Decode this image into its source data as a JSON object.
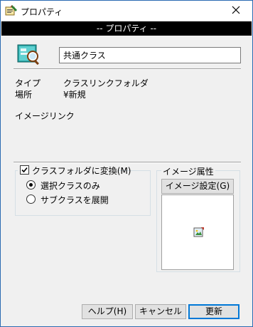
{
  "window": {
    "title": "プロパティ",
    "header": "-- プロパティ --"
  },
  "name_field": {
    "value": "共通クラス"
  },
  "info": {
    "type_label": "タイプ",
    "type_value": "クラスリンクフォルダ",
    "location_label": "場所",
    "location_value": "¥新規",
    "image_link_label": "イメージリンク"
  },
  "class_folder_group": {
    "checkbox_label": "クラスフォルダに変換(M)",
    "checkbox_checked": true,
    "radio_selected_only": "選択クラスのみ",
    "radio_expand_subclasses": "サブクラスを展開",
    "selected_radio": "選択クラスのみ"
  },
  "image_attr_group": {
    "label": "イメージ属性",
    "settings_button": "イメージ設定(G)"
  },
  "footer": {
    "help_button": "ヘルプ(H)",
    "cancel_button": "キャンセル",
    "update_button": "更新"
  },
  "icons": {
    "title_icon": "properties-app-icon",
    "close_icon": "close-icon",
    "big_icon": "class-folder-icon",
    "preview_icon": "image-placeholder-icon"
  }
}
